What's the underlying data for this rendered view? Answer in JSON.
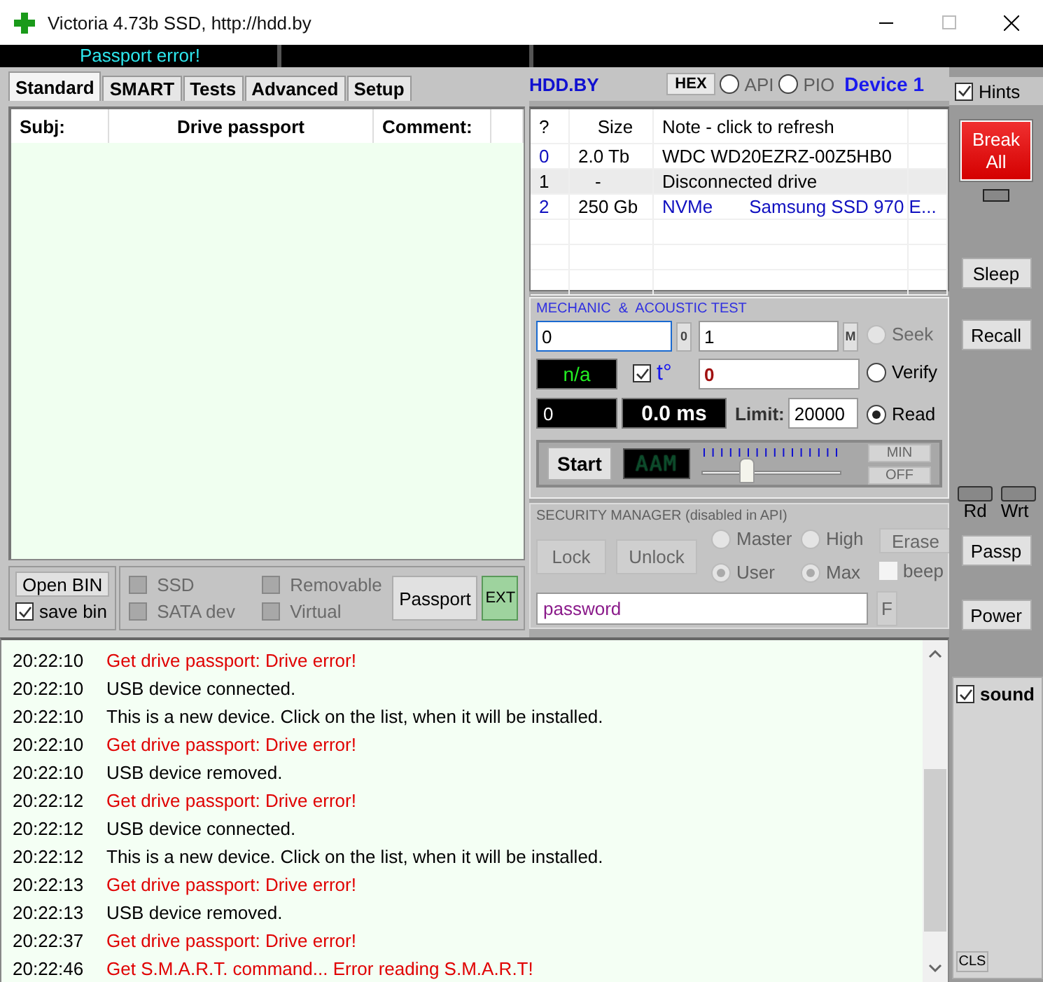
{
  "window": {
    "title": "Victoria 4.73b SSD, http://hdd.by"
  },
  "status_message": "Passport error!",
  "tabs": [
    {
      "label": "Standard",
      "selected": true
    },
    {
      "label": "SMART",
      "selected": false
    },
    {
      "label": "Tests",
      "selected": false
    },
    {
      "label": "Advanced",
      "selected": false
    },
    {
      "label": "Setup",
      "selected": false
    }
  ],
  "passport_table": {
    "columns": [
      "Subj:",
      "Drive passport",
      "Comment:"
    ]
  },
  "passport_controls": {
    "open_bin": "Open BIN",
    "save_bin": {
      "label": "save bin",
      "checked": true
    },
    "flags": [
      {
        "label": "SSD",
        "checked": false
      },
      {
        "label": "Removable",
        "checked": false
      },
      {
        "label": "SATA dev",
        "checked": false
      },
      {
        "label": "Virtual",
        "checked": false
      }
    ],
    "passport_button": "Passport",
    "ext_button": "EXT"
  },
  "header": {
    "brand": "HDD.BY",
    "hex_button": "HEX",
    "modes": [
      {
        "label": "API",
        "selected": false
      },
      {
        "label": "PIO",
        "selected": false
      }
    ],
    "device": "Device 1"
  },
  "hints": {
    "label": "Hints",
    "checked": true
  },
  "drives": {
    "columns": [
      "?",
      "Size",
      "Note - click to refresh"
    ],
    "rows": [
      {
        "index": "0",
        "size": "2.0 Tb",
        "note": "WDC WD20EZRZ-00Z5HB0",
        "kind": "sata",
        "selected": false
      },
      {
        "index": "1",
        "size": "-",
        "note": "Disconnected drive",
        "kind": "missing",
        "selected": true
      },
      {
        "index": "2",
        "size": "250 Gb",
        "interface": "NVMe",
        "note": "Samsung SSD 970 E...",
        "kind": "nvme",
        "selected": false
      }
    ]
  },
  "mechanic": {
    "title": "MECHANIC  &  ACOUSTIC TEST",
    "start_value": "0",
    "start_button": "0",
    "end_value": "1",
    "end_button": "M",
    "temperature": "n/a",
    "temperature_toggle": {
      "label": "t°",
      "checked": true
    },
    "error_value": "0",
    "counter": "0",
    "time": "0.0 ms",
    "limit_label": "Limit:",
    "limit": "20000",
    "modes": [
      {
        "label": "Seek",
        "selected": false,
        "disabled": true
      },
      {
        "label": "Verify",
        "selected": false,
        "disabled": false
      },
      {
        "label": "Read",
        "selected": true,
        "disabled": false
      }
    ],
    "run_button": "Start",
    "aam_display": "AAM",
    "aam": {
      "level": 0.32
    },
    "min_button": "MIN",
    "off_button": "OFF"
  },
  "security": {
    "title": "SECURITY MANAGER (disabled in API)",
    "lock_button": "Lock",
    "unlock_button": "Unlock",
    "options": [
      {
        "label": "Master",
        "selected": false
      },
      {
        "label": "High",
        "selected": false
      },
      {
        "label": "User",
        "selected": true
      },
      {
        "label": "Max",
        "selected": true
      }
    ],
    "erase_button": "Erase",
    "beep": {
      "label": "beep",
      "checked": false
    },
    "password": "password",
    "f_button": "F"
  },
  "side_buttons": {
    "break": "Break All",
    "sleep": "Sleep",
    "recall": "Recall",
    "read_led": "Rd",
    "write_led": "Wrt",
    "passp": "Passp",
    "power": "Power"
  },
  "log": [
    {
      "time": "20:22:10",
      "text": "Get drive passport: Drive error!",
      "kind": "error"
    },
    {
      "time": "20:22:10",
      "text": "USB device connected.",
      "kind": "info"
    },
    {
      "time": "20:22:10",
      "text": "This is a new device. Click on the list, when it will be installed.",
      "kind": "info"
    },
    {
      "time": "20:22:10",
      "text": "Get drive passport: Drive error!",
      "kind": "error"
    },
    {
      "time": "20:22:10",
      "text": "USB device removed.",
      "kind": "info"
    },
    {
      "time": "20:22:12",
      "text": "Get drive passport: Drive error!",
      "kind": "error"
    },
    {
      "time": "20:22:12",
      "text": "USB device connected.",
      "kind": "info"
    },
    {
      "time": "20:22:12",
      "text": "This is a new device. Click on the list, when it will be installed.",
      "kind": "info"
    },
    {
      "time": "20:22:13",
      "text": "Get drive passport: Drive error!",
      "kind": "error"
    },
    {
      "time": "20:22:13",
      "text": "USB device removed.",
      "kind": "info"
    },
    {
      "time": "20:22:37",
      "text": "Get drive passport: Drive error!",
      "kind": "error"
    },
    {
      "time": "20:22:46",
      "text": "Get S.M.A.R.T. command... Error reading S.M.A.R.T!",
      "kind": "error"
    }
  ],
  "sound": {
    "label": "sound",
    "checked": true
  },
  "cls_button": "CLS"
}
